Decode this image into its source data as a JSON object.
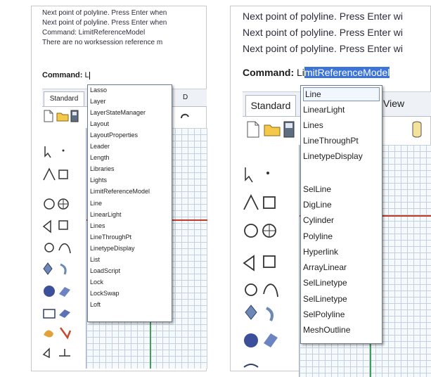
{
  "left": {
    "history": [
      "Next point of polyline. Press Enter when",
      "Next point of polyline. Press Enter when",
      "Command: LimitReferenceModel",
      "There are no worksession reference m"
    ],
    "command_label": "Command:",
    "command_input": "L",
    "tabs": [
      {
        "label": "Standard"
      },
      {
        "label": "D"
      }
    ],
    "dropdown_items": [
      "Lasso",
      "Layer",
      "LayerStateManager",
      "Layout",
      "LayoutProperties",
      "Leader",
      "Length",
      "Libraries",
      "Lights",
      "LimitReferenceModel",
      "Line",
      "LinearLight",
      "Lines",
      "LineThroughPt",
      "LinetypeDisplay",
      "List",
      "LoadScript",
      "Lock",
      "LockSwap",
      "Loft"
    ]
  },
  "right": {
    "history": [
      "Next point of polyline. Press Enter wi",
      "Next point of polyline. Press Enter wi",
      "Next point of polyline. Press Enter wi"
    ],
    "command_label": "Command:",
    "command_typed": "Li",
    "command_autocomplete": "mitReferenceModel",
    "tabs": [
      {
        "label": "Standard"
      },
      {
        "label": "View"
      }
    ],
    "dropdown_items": [
      "Line",
      "LinearLight",
      "Lines",
      "LineThroughPt",
      "LinetypeDisplay",
      "",
      "SelLine",
      "DigLine",
      "Cylinder",
      "Polyline",
      "Hyperlink",
      "ArrayLinear",
      "SelLinetype",
      "SelLinetype",
      "SelPolyline",
      "MeshOutline"
    ]
  },
  "colors": {
    "selection": "#3b73d6",
    "x_axis": "#c23a2a",
    "y_axis": "#3aa05a"
  },
  "icons": [
    "new-file-icon",
    "open-folder-icon",
    "save-icon",
    "select-arrow-icon",
    "polyline-icon",
    "circle-icon",
    "curve-icon",
    "surface-icon",
    "solid-icon",
    "mesh-icon",
    "transform-icon"
  ]
}
